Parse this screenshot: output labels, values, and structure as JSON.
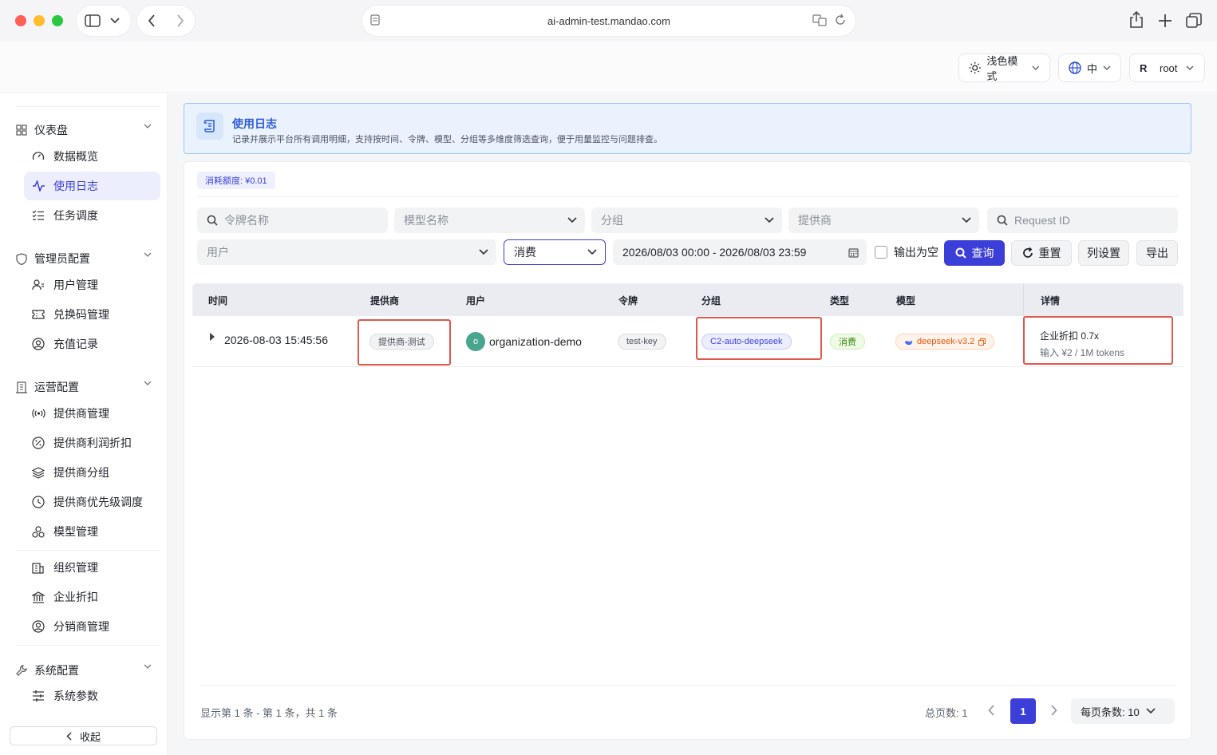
{
  "browser": {
    "url": "ai-admin-test.mandao.com"
  },
  "header": {
    "theme_label": "浅色模式",
    "lang_label": "中",
    "user_initial": "R",
    "user_name": "root"
  },
  "sidebar": {
    "groups": [
      {
        "label": "仪表盘",
        "icon": "grid-icon",
        "items": [
          {
            "label": "数据概览",
            "icon": "gauge-icon"
          },
          {
            "label": "使用日志",
            "icon": "activity-icon",
            "active": true
          },
          {
            "label": "任务调度",
            "icon": "list-check-icon"
          }
        ]
      },
      {
        "label": "管理员配置",
        "icon": "shield-icon",
        "items": [
          {
            "label": "用户管理",
            "icon": "users-icon"
          },
          {
            "label": "兑换码管理",
            "icon": "ticket-icon"
          },
          {
            "label": "充值记录",
            "icon": "user-circle-icon"
          }
        ]
      },
      {
        "label": "运营配置",
        "icon": "building-icon",
        "items": [
          {
            "label": "提供商管理",
            "icon": "broadcast-icon"
          },
          {
            "label": "提供商利润折扣",
            "icon": "percent-icon"
          },
          {
            "label": "提供商分组",
            "icon": "layers-icon"
          },
          {
            "label": "提供商优先级调度",
            "icon": "clock-icon"
          },
          {
            "label": "模型管理",
            "icon": "boxes-icon"
          },
          {
            "label": "组织管理",
            "icon": "office-icon"
          },
          {
            "label": "企业折扣",
            "icon": "bank-icon"
          },
          {
            "label": "分销商管理",
            "icon": "user-circle-icon"
          }
        ]
      },
      {
        "label": "系统配置",
        "icon": "wrench-icon",
        "items": [
          {
            "label": "系统参数",
            "icon": "sliders-icon"
          }
        ]
      }
    ],
    "collapse_label": "收起"
  },
  "banner": {
    "title": "使用日志",
    "description": "记录并展示平台所有调用明细，支持按时间、令牌、模型、分组等多维度筛选查询，便于用量监控与问题排查。"
  },
  "quota": {
    "label": "消耗额度: ¥0.01"
  },
  "filters": {
    "token_placeholder": "令牌名称",
    "model_placeholder": "模型名称",
    "group_placeholder": "分组",
    "provider_placeholder": "提供商",
    "request_id_placeholder": "Request ID",
    "user_placeholder": "用户",
    "type_value": "消费",
    "date_range": "2026/08/03 00:00 - 2026/08/03 23:59",
    "empty_output_label": "输出为空",
    "query_label": "查询",
    "reset_label": "重置",
    "columns_label": "列设置",
    "export_label": "导出"
  },
  "table": {
    "columns": [
      "时间",
      "提供商",
      "用户",
      "令牌",
      "分组",
      "类型",
      "模型",
      "详情"
    ],
    "rows": [
      {
        "time": "2026-08-03 15:45:56",
        "provider": "提供商-测试",
        "user_initial": "o",
        "user": "organization-demo",
        "token": "test-key",
        "group": "C2-auto-deepseek",
        "type": "消费",
        "model": "deepseek-v3.2",
        "detail_line1": "企业折扣 0.7x",
        "detail_line2": "输入 ¥2 / 1M tokens"
      }
    ]
  },
  "pagination": {
    "summary": "显示第 1 条 - 第 1 条，共 1 条",
    "total_pages_label": "总页数: 1",
    "current_page": "1",
    "per_page_label": "每页条数: 10"
  },
  "colors": {
    "accent": "#3b3fd8",
    "highlight": "#e2574c",
    "banner_bg": "#eaf3fd"
  }
}
